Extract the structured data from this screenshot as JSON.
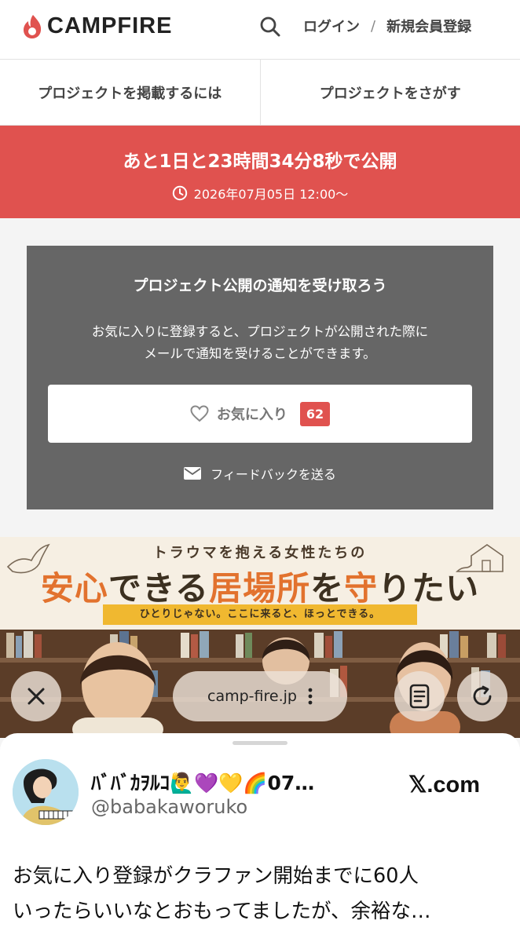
{
  "header": {
    "logo_text": "CAMPFIRE",
    "login_label": "ログイン",
    "separator": "/",
    "signup_label": "新規会員登録"
  },
  "nav": {
    "items": [
      {
        "label": "プロジェクトを掲載するには"
      },
      {
        "label": "プロジェクトをさがす"
      }
    ]
  },
  "banner": {
    "countdown": "あと1日と23時間34分8秒で公開",
    "open_date": "2026年07月05日 12:00〜"
  },
  "notify": {
    "title": "プロジェクト公開の通知を受け取ろう",
    "desc_line1": "お気に入りに登録すると、プロジェクトが公開された際に",
    "desc_line2": "メールで通知を受けることができます。",
    "favorite_label": "お気に入り",
    "favorite_count": "62",
    "feedback_label": "フィードバックを送る"
  },
  "hero": {
    "subtitle": "トラウマを抱える女性たちの",
    "title_part1": "安心",
    "title_part2": "できる",
    "title_part3": "居場所",
    "title_part4": "を",
    "title_part5": "守",
    "title_part6": "りたい",
    "tagline": "ひとりじゃない。ここに来ると、ほっとできる。"
  },
  "browser": {
    "url": "camp-fire.jp"
  },
  "sheet": {
    "display_name": "ﾊﾞﾊﾞｶｦﾙｺ🙋‍♂️💜💛🌈07…",
    "handle": "@babakaworuko",
    "source": "𝕏.com",
    "tweet_line1": "お気に入り登録がクラファン開始までに60人",
    "tweet_line2": "いったらいいなとおもってましたが、余裕な…"
  },
  "colors": {
    "accent_red": "#e0524f",
    "notify_bg": "#666666",
    "hero_accent": "#e2722e",
    "tagline_bg": "#f0b830"
  }
}
